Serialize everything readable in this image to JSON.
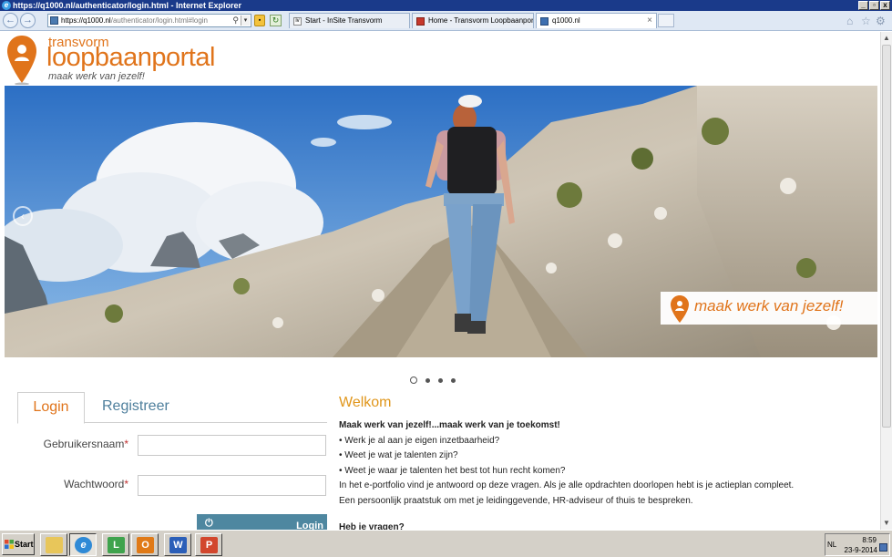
{
  "window": {
    "title": "https://q1000.nl/authenticator/login.html - Internet Explorer",
    "controls": [
      "_",
      "▫",
      "x"
    ]
  },
  "browser": {
    "address": {
      "url_prefix": "https://q1000.nl",
      "url_suffix": "/authenticator/login.html#login"
    },
    "tabs": [
      {
        "label": "Start - InSite Transvorm",
        "icon": "insite-icon"
      },
      {
        "label": "Home - Transvorm Loopbaanportal",
        "icon": "portal-icon"
      },
      {
        "label": "q1000.nl",
        "icon": "page-icon",
        "active": true
      }
    ],
    "tab_close": "×"
  },
  "logo": {
    "line1": "transvorm",
    "line2": "loopbaanportal",
    "tagline": "maak werk van jezelf!",
    "color": "#e0741b"
  },
  "hero": {
    "banner_text": "maak werk van jezelf!",
    "slides_count": 4,
    "active_slide": 1
  },
  "auth": {
    "tab_login": "Login",
    "tab_register": "Registreer",
    "username_label": "Gebruikersnaam",
    "password_label": "Wachtwoord",
    "required_marker": "*",
    "login_button": "Login",
    "accent": "#e0741b",
    "button_color": "#4e87a0"
  },
  "welcome": {
    "title": "Welkom",
    "headline": "Maak werk van jezelf!...maak werk van je toekomst!",
    "bullets": [
      "• Werk je al aan je eigen inzetbaarheid?",
      "• Weet je wat je talenten zijn?",
      "• Weet je waar je talenten het best tot hun recht komen?"
    ],
    "paragraph1": "In het e-portfolio vind je antwoord op deze vragen. Als je alle opdrachten doorlopen hebt is je actieplan compleet.",
    "paragraph2": "Een persoonlijk praatstuk om met je leidinggevende, HR-adviseur of thuis te bespreken.",
    "question": "Heb je vragen?"
  },
  "taskbar": {
    "start_label": "Start",
    "apps": [
      "explorer-folder",
      "internet-explorer",
      "lync",
      "outlook",
      "word",
      "powerpoint"
    ],
    "language": "NL",
    "time": "8:59",
    "date": "23-9-2014"
  }
}
